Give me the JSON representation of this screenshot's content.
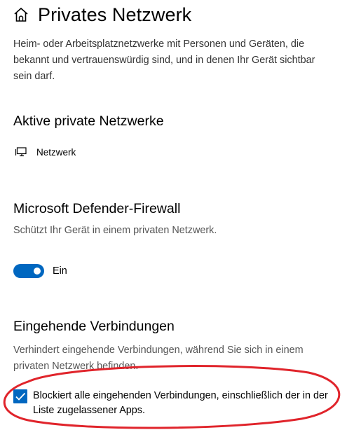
{
  "header": {
    "title": "Privates Netzwerk",
    "icon": "home-icon"
  },
  "description": "Heim- oder Arbeitsplatznetzwerke mit Personen und Geräten, die bekannt und vertrauenswürdig sind, und in denen Ihr Gerät sichtbar sein darf.",
  "active_networks": {
    "title": "Aktive private Netzwerke",
    "network_name": "Netzwerk",
    "network_icon": "pc-monitor-icon"
  },
  "firewall": {
    "title": "Microsoft Defender-Firewall",
    "subtitle": "Schützt Ihr Gerät in einem privaten Netzwerk.",
    "toggle_state": "on",
    "toggle_label": "Ein"
  },
  "incoming": {
    "title": "Eingehende Verbindungen",
    "subtitle": "Verhindert eingehende Verbindungen, während Sie sich in einem privaten Netzwerk befinden.",
    "checkbox_checked": true,
    "checkbox_label": "Blockiert alle eingehenden Verbindungen, einschließlich der in der Liste zugelassener Apps."
  },
  "colors": {
    "accent": "#0067c0",
    "annotation": "#e0242b"
  }
}
